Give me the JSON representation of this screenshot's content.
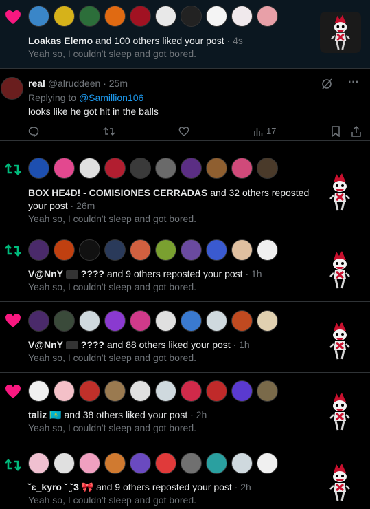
{
  "colors": {
    "like": "#f91880",
    "repost": "#00ba7c",
    "link": "#1d9bf0",
    "muted": "#71767b",
    "bg": "#000000",
    "highlight_bg": "#0b1720",
    "divider": "#2f3336"
  },
  "notifications": [
    {
      "type": "like",
      "actor": "Loakas Elemo",
      "others": "and 100 others liked your post",
      "time": "· 4s",
      "preview": "Yeah so, I couldn't sleep and got bored.",
      "avatars": [
        "#3a86c8",
        "#d6b21a",
        "#2c6e3a",
        "#e06a12",
        "#a11222",
        "#e8e8e8",
        "#222222",
        "#f4f4f4",
        "#f0e9ec",
        "#e8a0a8"
      ]
    },
    {
      "type": "reply",
      "name": "real",
      "handle": "@alruddeen",
      "time": "· 25m",
      "replying_label": "Replying to",
      "replying_to": "@Samillion106",
      "text": "looks like he got hit in the balls",
      "views": "17"
    },
    {
      "type": "repost",
      "actor": "BOX HE4D! - COMISIONES CERRADAS",
      "others": "and 32 others reposted",
      "others2": "your post",
      "time": "· 26m",
      "preview": "Yeah so, I couldn't sleep and got bored.",
      "avatars": [
        "#1d4fb0",
        "#e3488f",
        "#e0e0e0",
        "#b21e30",
        "#3a3a3a",
        "#6a6a6a",
        "#5b2e84",
        "#8f5f30",
        "#d04a7a",
        "#4a3a2a"
      ]
    },
    {
      "type": "repost",
      "actor": "V@NnY",
      "actor_suffix": "????",
      "others": "and 9 others reposted your post",
      "time": "· 1h",
      "preview": "Yeah so, I couldn't sleep and got bored.",
      "avatars": [
        "#4a2a6a",
        "#c04010",
        "#111111",
        "#2a3a5a",
        "#d06040",
        "#7aa030",
        "#6a4aa0",
        "#3a5ad0",
        "#e0c0a0",
        "#f0f0f0"
      ]
    },
    {
      "type": "like",
      "actor": "V@NnY",
      "actor_suffix": "????",
      "others": "and 88 others liked your post",
      "time": "· 1h",
      "preview": "Yeah so, I couldn't sleep and got bored.",
      "avatars": [
        "#4a2a6a",
        "#3a4a3a",
        "#cfd9de",
        "#8a3ad0",
        "#d03a8a",
        "#e0e0e0",
        "#3a7ad0",
        "#cfd9de",
        "#c04a20",
        "#e0d0b0"
      ]
    },
    {
      "type": "like",
      "actor": "taliz",
      "actor_emoji": "🇰🇿",
      "others": "and 38 others liked your post",
      "time": "· 2h",
      "preview": "Yeah so, I couldn't sleep and got bored.",
      "avatars": [
        "#f0f0f0",
        "#f4c0c8",
        "#c0302a",
        "#9a7a50",
        "#e0e0e0",
        "#cfd9de",
        "#d02a4a",
        "#c02a2a",
        "#5a3ad0",
        "#7a6a4a"
      ]
    },
    {
      "type": "repost",
      "actor": "˘ɛ_kyro ˘ ̮̮˘3",
      "actor_emoji": "🎀",
      "others": "and 9 others reposted your post",
      "time": "· 2h",
      "preview": "Yeah so, I couldn't sleep and got bored.",
      "avatars": [
        "#f0c0d0",
        "#e0e0e0",
        "#f0a0c0",
        "#d07a30",
        "#6a4ac0",
        "#e03a3a",
        "#707070",
        "#2aa0a0",
        "#cfd9de",
        "#f0f0f0"
      ]
    }
  ]
}
